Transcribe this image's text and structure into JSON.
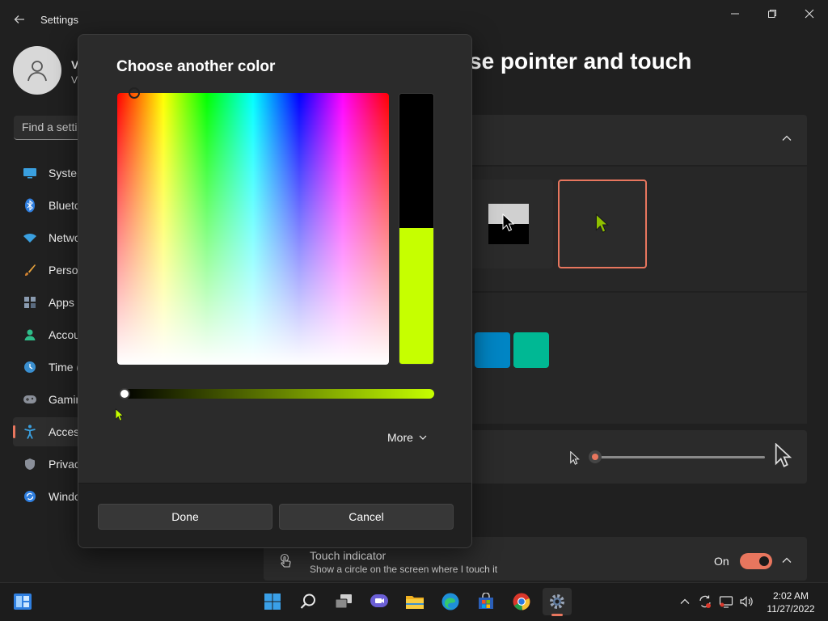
{
  "window": {
    "app_title": "Settings",
    "page_title_partial": "se pointer and touch"
  },
  "user": {
    "name_partial": "V",
    "sub_partial": "V"
  },
  "search": {
    "placeholder": "Find a setti"
  },
  "sidebar": {
    "items": [
      {
        "label": "Syster",
        "icon": "system-icon"
      },
      {
        "label": "Blueto",
        "icon": "bluetooth-icon"
      },
      {
        "label": "Netwo",
        "icon": "network-icon"
      },
      {
        "label": "Person",
        "icon": "personalization-icon"
      },
      {
        "label": "Apps",
        "icon": "apps-icon"
      },
      {
        "label": "Accou",
        "icon": "accounts-icon"
      },
      {
        "label": "Time (",
        "icon": "time-icon"
      },
      {
        "label": "Gamin",
        "icon": "gaming-icon"
      },
      {
        "label": "Acces",
        "icon": "accessibility-icon",
        "active": true
      },
      {
        "label": "Privac",
        "icon": "privacy-icon"
      },
      {
        "label": "Windo",
        "icon": "windows-update-icon"
      }
    ]
  },
  "dialog": {
    "title": "Choose another color",
    "selected_color": "#c6ff00",
    "previous_color": "#000000",
    "value_level": 0.0,
    "more_label": "More",
    "done_label": "Done",
    "cancel_label": "Cancel"
  },
  "swatches": [
    "#0085c4",
    "#00b894"
  ],
  "touch_indicator": {
    "title": "Touch indicator",
    "description": "Show a circle on the screen where I touch it",
    "state_label": "On"
  },
  "taskbar": {
    "apps": [
      "start",
      "search",
      "task-view",
      "chat",
      "file-explorer",
      "edge",
      "store",
      "chrome",
      "settings"
    ]
  },
  "clock": {
    "time": "2:02 AM",
    "date": "11/27/2022"
  },
  "colors": {
    "accent": "#e8765e",
    "background": "#202020",
    "card": "#2b2b2b"
  }
}
